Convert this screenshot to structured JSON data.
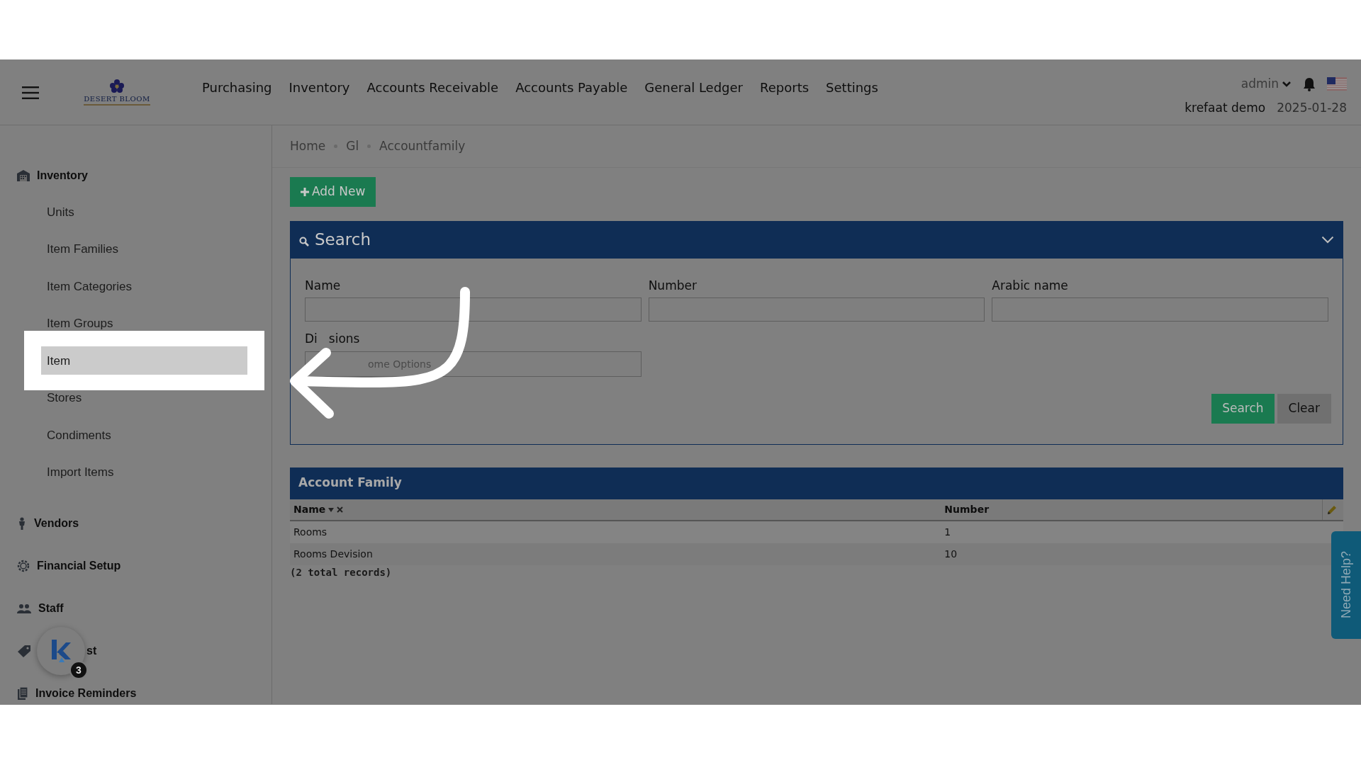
{
  "header": {
    "logo_text": "DESERT BLOOM",
    "nav": [
      "Purchasing",
      "Inventory",
      "Accounts Receivable",
      "Accounts Payable",
      "General Ledger",
      "Reports",
      "Settings"
    ],
    "user": "admin",
    "company": "krefaat demo",
    "date": "2025-01-28"
  },
  "sidebar": {
    "items": [
      {
        "label": "Inventory",
        "children": [
          {
            "label": "Units",
            "selected": false
          },
          {
            "label": "Item Families",
            "selected": false
          },
          {
            "label": "Item Categories",
            "selected": false
          },
          {
            "label": "Item Groups",
            "selected": false
          },
          {
            "label": "Item",
            "selected": true
          },
          {
            "label": "Stores",
            "selected": false
          },
          {
            "label": "Condiments",
            "selected": false
          },
          {
            "label": "Import Items",
            "selected": false
          }
        ]
      },
      {
        "label": "Vendors"
      },
      {
        "label": "Financial Setup"
      },
      {
        "label": "Staff"
      },
      {
        "label": "st",
        "widget": {
          "badge": "3"
        }
      },
      {
        "label": "Invoice Reminders"
      }
    ]
  },
  "breadcrumb": [
    "Home",
    "Gl",
    "Accountfamily"
  ],
  "add_button": "Add New",
  "search_panel": {
    "title": "Search",
    "fields": [
      {
        "label": "Name",
        "kind": "text"
      },
      {
        "label": "Number",
        "kind": "text"
      },
      {
        "label": "Arabic name",
        "kind": "text"
      },
      {
        "label_parts": [
          "Di",
          "sions"
        ],
        "kind": "select",
        "placeholder": "ome Options"
      }
    ],
    "buttons": [
      {
        "label": "Search",
        "kind": "primary"
      },
      {
        "label": "Clear",
        "kind": "secondary"
      }
    ]
  },
  "table": {
    "title": "Account Family",
    "columns": [
      {
        "label": "Name",
        "sorted": true
      },
      {
        "label": "Number",
        "sorted": false
      }
    ],
    "rows": [
      [
        "Rooms",
        "1"
      ],
      [
        "Rooms Devision",
        "10"
      ]
    ],
    "footer": "(2 total records)"
  },
  "help_tab": "Need Help?"
}
